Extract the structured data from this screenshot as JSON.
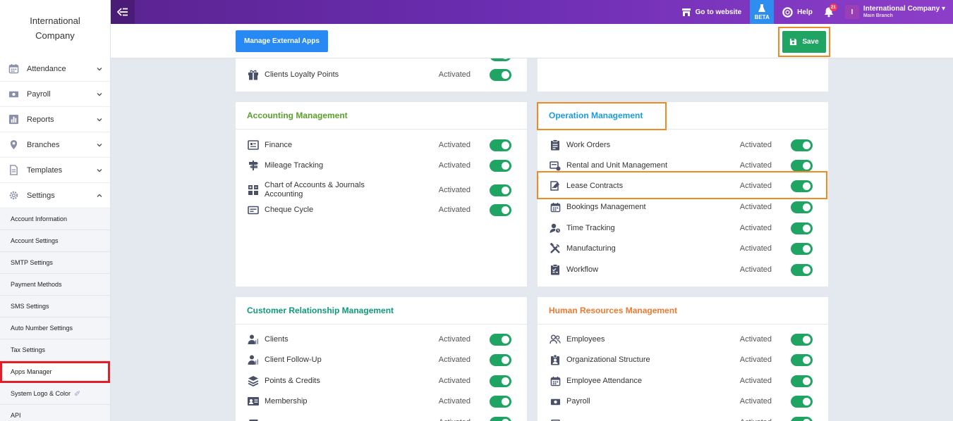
{
  "sidebar": {
    "company_line1": "International",
    "company_line2": "Company",
    "items": [
      {
        "label": "Attendance"
      },
      {
        "label": "Payroll"
      },
      {
        "label": "Reports"
      },
      {
        "label": "Branches"
      },
      {
        "label": "Templates"
      },
      {
        "label": "Settings"
      }
    ],
    "settings_sub": [
      "Account Information",
      "Account Settings",
      "SMTP Settings",
      "Payment Methods",
      "SMS Settings",
      "Auto Number Settings",
      "Tax Settings",
      "Apps Manager",
      "System Logo & Color",
      "API"
    ],
    "active_sub": "Apps Manager"
  },
  "topbar": {
    "go_to_website": "Go to website",
    "beta": "BETA",
    "help": "Help",
    "notifications_count": "21",
    "account_initial": "I",
    "account_name": "International Company",
    "account_branch": "Main Branch"
  },
  "actions": {
    "manage_external": "Manage External Apps",
    "save": "Save"
  },
  "status_label": "Activated",
  "colors": {
    "accent_green": "#1fa463",
    "highlight_orange": "#f08a24",
    "accounting": "#5aa02c",
    "operation": "#1e9be0",
    "crm": "#0f9a7a",
    "hr": "#ee7a30"
  },
  "cards": {
    "top_left": {
      "items": [
        {
          "label": "Clients Loyalty Points",
          "icon": "gift-icon"
        }
      ]
    },
    "accounting": {
      "title": "Accounting Management",
      "items": [
        {
          "label": "Finance",
          "icon": "finance-icon"
        },
        {
          "label": "Mileage Tracking",
          "icon": "signpost-icon"
        },
        {
          "label": "Chart of Accounts & Journals Accounting",
          "icon": "calculator-icon"
        },
        {
          "label": "Cheque Cycle",
          "icon": "cheque-icon"
        }
      ]
    },
    "operation": {
      "title": "Operation Management",
      "items": [
        {
          "label": "Work Orders",
          "icon": "clipboard-icon"
        },
        {
          "label": "Rental and Unit Management",
          "icon": "rental-icon"
        },
        {
          "label": "Lease Contracts",
          "icon": "contract-icon"
        },
        {
          "label": "Bookings Management",
          "icon": "calendar-icon"
        },
        {
          "label": "Time Tracking",
          "icon": "user-clock-icon"
        },
        {
          "label": "Manufacturing",
          "icon": "tools-icon"
        },
        {
          "label": "Workflow",
          "icon": "checklist-icon"
        }
      ]
    },
    "crm": {
      "title": "Customer Relationship Management",
      "items": [
        {
          "label": "Clients",
          "icon": "user-chart-icon"
        },
        {
          "label": "Client Follow-Up",
          "icon": "user-chart-icon"
        },
        {
          "label": "Points & Credits",
          "icon": "layers-icon"
        },
        {
          "label": "Membership",
          "icon": "id-card-icon"
        }
      ]
    },
    "hr": {
      "title": "Human Resources Management",
      "items": [
        {
          "label": "Employees",
          "icon": "users-icon"
        },
        {
          "label": "Organizational Structure",
          "icon": "badge-icon"
        },
        {
          "label": "Employee Attendance",
          "icon": "calendar-icon"
        },
        {
          "label": "Payroll",
          "icon": "money-icon"
        }
      ]
    }
  }
}
